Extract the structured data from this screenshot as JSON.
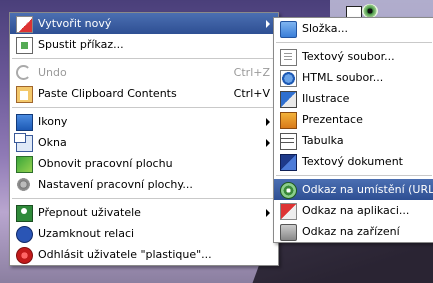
{
  "main_menu": {
    "items": [
      {
        "label": "Vytvořit nový",
        "icon": "new-document-icon",
        "submenu": true,
        "highlight": true
      },
      {
        "label": "Spustit příkaz...",
        "icon": "run-command-icon"
      },
      {
        "label": "Undo",
        "shortcut": "Ctrl+Z",
        "icon": "undo-icon",
        "disabled": true
      },
      {
        "label": "Paste Clipboard Contents",
        "shortcut": "Ctrl+V",
        "icon": "paste-icon"
      },
      {
        "label": "Ikony",
        "icon": "icons-icon",
        "submenu": true
      },
      {
        "label": "Okna",
        "icon": "windows-icon",
        "submenu": true
      },
      {
        "label": "Obnovit pracovní plochu",
        "icon": "refresh-desktop-icon"
      },
      {
        "label": "Nastavení pracovní plochy...",
        "icon": "desktop-settings-icon"
      },
      {
        "label": "Přepnout uživatele",
        "icon": "switch-user-icon",
        "submenu": true
      },
      {
        "label": "Uzamknout relaci",
        "icon": "lock-session-icon"
      },
      {
        "label": "Odhlásit uživatele \"plastique\"...",
        "icon": "logout-icon"
      }
    ]
  },
  "sub_menu": {
    "items": [
      {
        "label": "Složka...",
        "icon": "folder-icon"
      },
      {
        "label": "Textový soubor...",
        "icon": "text-file-icon"
      },
      {
        "label": "HTML soubor...",
        "icon": "html-file-icon"
      },
      {
        "label": "Ilustrace",
        "icon": "illustration-icon"
      },
      {
        "label": "Prezentace",
        "icon": "presentation-icon"
      },
      {
        "label": "Tabulka",
        "icon": "spreadsheet-icon"
      },
      {
        "label": "Textový dokument",
        "icon": "text-document-icon"
      },
      {
        "label": "Odkaz na umístění (URL)...",
        "icon": "link-url-icon",
        "highlight": true
      },
      {
        "label": "Odkaz na aplikaci...",
        "icon": "link-application-icon"
      },
      {
        "label": "Odkaz na zařízení",
        "icon": "link-device-icon"
      }
    ]
  },
  "colors": {
    "highlight": "#2e4f93",
    "menu_bg": "#ffffff",
    "disabled_text": "#9a9a9a"
  }
}
